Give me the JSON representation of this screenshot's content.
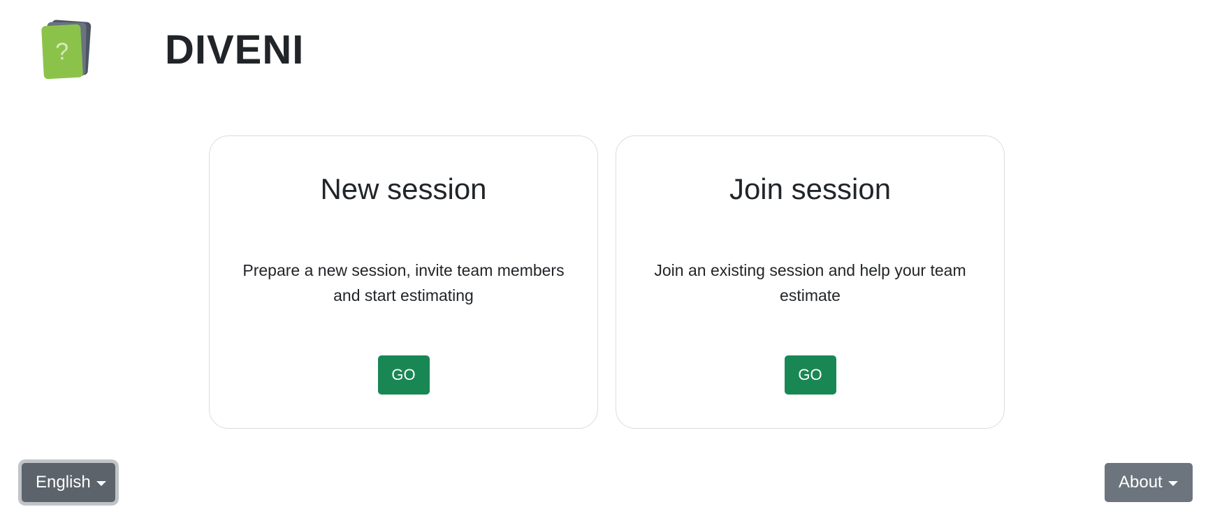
{
  "header": {
    "app_title": "DIVENI",
    "logo_glyph": "?"
  },
  "cards": [
    {
      "title": "New session",
      "description": "Prepare a new session, invite team members and start estimating",
      "button_label": "GO"
    },
    {
      "title": "Join session",
      "description": "Join an existing session and help your team estimate",
      "button_label": "GO"
    }
  ],
  "footer": {
    "language_label": "English",
    "about_label": "About"
  },
  "colors": {
    "go_button": "#198754",
    "secondary_button": "#6c757d",
    "logo_green": "#8bc34a"
  },
  "icons": {
    "logo": "question-card-stack-icon",
    "dropdown": "caret-down-icon"
  }
}
